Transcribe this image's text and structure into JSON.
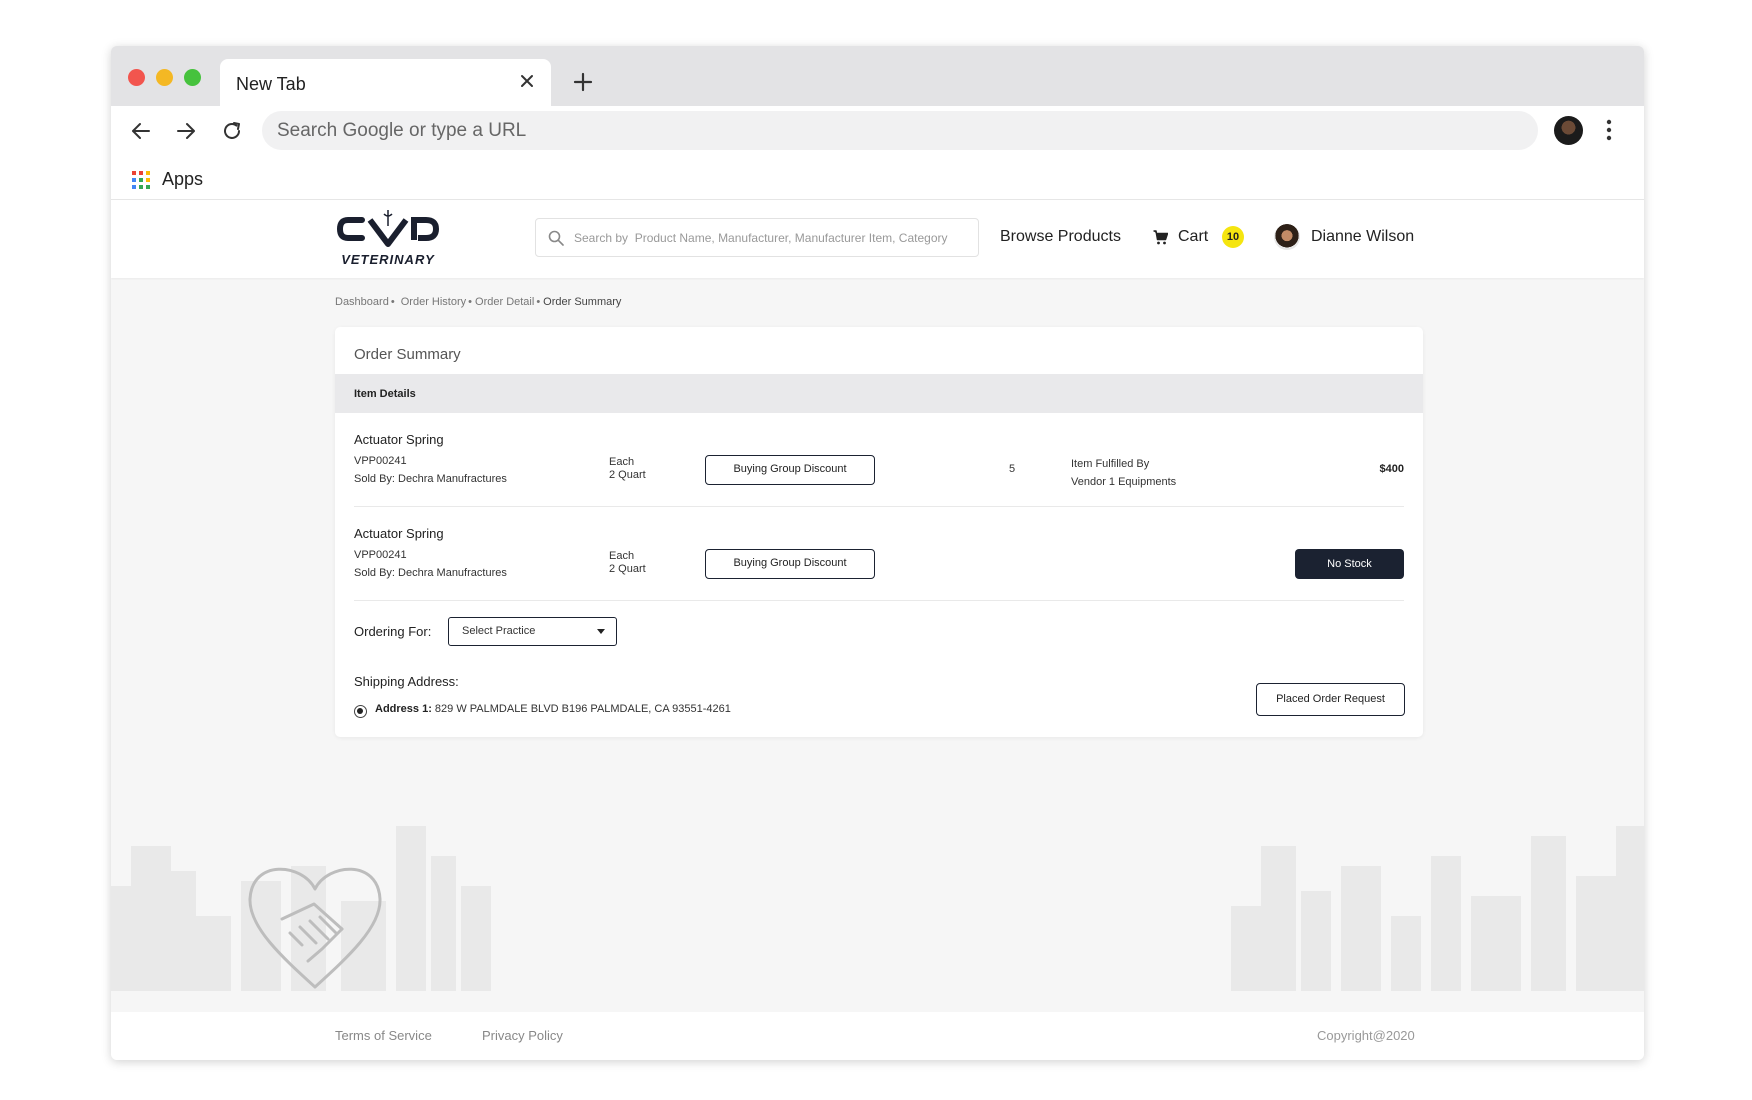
{
  "browser": {
    "tab_title": "New Tab",
    "address_placeholder": "Search Google or type a URL",
    "bookmarks": {
      "apps_label": "Apps"
    }
  },
  "site": {
    "logo_text": "VETERINARY",
    "search_placeholder": "Search by  Product Name, Manufacturer, Manufacturer Item, Category",
    "nav": {
      "browse_label": "Browse Products",
      "cart_label": "Cart",
      "cart_count": "10"
    },
    "user": {
      "name": "Dianne Wilson"
    }
  },
  "breadcrumb": {
    "dashboard": "Dashboard",
    "order_history": "Order History",
    "order_detail": "Order Detail",
    "current": "Order Summary",
    "separator": "•"
  },
  "order_summary": {
    "title": "Order Summary",
    "section_label": "Item Details",
    "items": [
      {
        "name": "Actuator Spring",
        "sku": "VPP00241",
        "sold_by": "Sold By: Dechra Manufractures",
        "unit_1": "Each",
        "unit_2": "2 Quart",
        "discount_label": "Buying Group Discount",
        "quantity": "5",
        "fulfilled_label": "Item Fulfilled By",
        "fulfilled_by": "Vendor 1 Equipments",
        "price": "$400"
      },
      {
        "name": "Actuator Spring",
        "sku": "VPP00241",
        "sold_by": "Sold By: Dechra Manufractures",
        "unit_1": "Each",
        "unit_2": "2 Quart",
        "discount_label": "Buying Group Discount",
        "stock_status": "No Stock"
      }
    ],
    "ordering_for_label": "Ordering For:",
    "select_practice": "Select Practice",
    "shipping_label": "Shipping Address:",
    "address_label": "Address 1:",
    "address_value": "829 W PALMDALE BLVD B196 PALMDALE, CA 93551-4261",
    "place_order_label": "Placed Order Request"
  },
  "footer": {
    "terms": "Terms of Service",
    "privacy": "Privacy Policy",
    "copyright": "Copyright@2020"
  },
  "colors": {
    "primary_dark": "#1b2231",
    "badge_yellow": "#f5e50f",
    "page_background": "#f6f6f6"
  },
  "icons": [
    "close-icon",
    "plus-icon",
    "back-arrow-icon",
    "forward-arrow-icon",
    "reload-icon",
    "kebab-menu-icon",
    "apps-grid-icon",
    "search-icon",
    "cart-icon",
    "handshake-heart-icon"
  ]
}
